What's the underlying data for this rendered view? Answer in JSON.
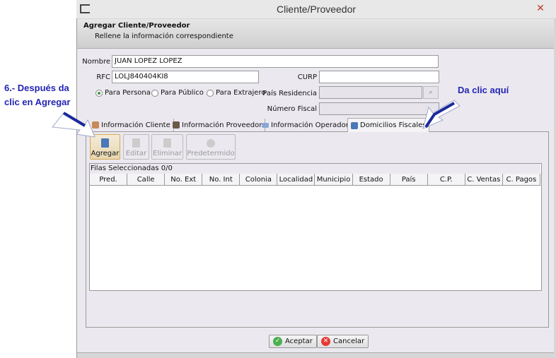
{
  "window": {
    "title": "Cliente/Proveedor",
    "close": "✕"
  },
  "header": {
    "title": "Agregar Cliente/Proveedor",
    "subtitle": "Rellene la información correspondiente"
  },
  "form": {
    "nombre_label": "Nombre",
    "nombre_value": "JUAN LOPEZ LOPEZ",
    "rfc_label": "RFC",
    "rfc_value": "LOLJ840404KI8",
    "curp_label": "CURP",
    "curp_value": "",
    "pais_label": "País Residencia",
    "pais_value": "",
    "numfiscal_label": "Número Fiscal",
    "numfiscal_value": "",
    "radios": [
      {
        "label": "Para Persona",
        "checked": true
      },
      {
        "label": "Para Público",
        "checked": false
      },
      {
        "label": "Para Extrajero",
        "checked": false
      }
    ]
  },
  "tabs": [
    {
      "label": "Información Cliente"
    },
    {
      "label": "Información Proveedor"
    },
    {
      "label": "Información Operador"
    },
    {
      "label": "Domicilios Fiscales",
      "active": true
    }
  ],
  "toolbar": {
    "agregar": "Agregar",
    "editar": "Editar",
    "eliminar": "Eliminar",
    "predeterminado": "Predetermido"
  },
  "table": {
    "status": "Filas Seleccionadas  0/0",
    "columns": [
      "Pred.",
      "Calle",
      "No. Ext",
      "No. Int",
      "Colonia",
      "Localidad",
      "Municipio",
      "Estado",
      "País",
      "C.P.",
      "C. Ventas",
      "C. Pagos"
    ],
    "rows": []
  },
  "footer": {
    "aceptar": "Aceptar",
    "cancelar": "Cancelar"
  },
  "annotations": {
    "step_line1": "6.-  Después da",
    "step_line2": "clic en Agregar",
    "click_here": "Da clic aquí",
    "color": "#2424b4"
  }
}
